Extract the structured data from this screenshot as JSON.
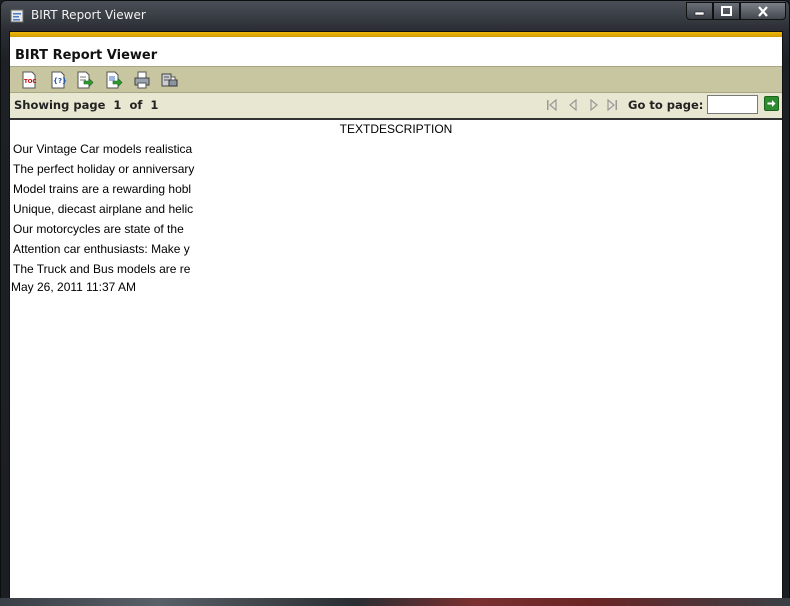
{
  "window": {
    "title": "BIRT Report Viewer"
  },
  "viewer": {
    "title": "BIRT Report Viewer",
    "toolbar": [
      {
        "name": "toc-icon"
      },
      {
        "name": "run-parameters-icon"
      },
      {
        "name": "export-data-icon"
      },
      {
        "name": "export-report-icon"
      },
      {
        "name": "print-icon"
      },
      {
        "name": "print-server-icon"
      }
    ],
    "nav": {
      "showing_label": "Showing page",
      "current_page": "1",
      "of_label": "of",
      "total_pages": "1",
      "goto_label": "Go to page:",
      "goto_value": ""
    }
  },
  "report": {
    "column_header": "TEXTDESCRIPTION",
    "rows": [
      "Our Vintage Car models realistica",
      "The perfect holiday or anniversary",
      "Model trains are a rewarding hobl",
      "Unique, diecast airplane and helic",
      "Our motorcycles are state of the",
      "Attention car enthusiasts: Make y",
      "The Truck and Bus models are re"
    ],
    "timestamp": "May 26, 2011 11:37 AM"
  },
  "colors": {
    "accent": "#f0b80a",
    "toolbar_bg": "#c8c6a0",
    "navbar_bg": "#e8e8d2"
  }
}
